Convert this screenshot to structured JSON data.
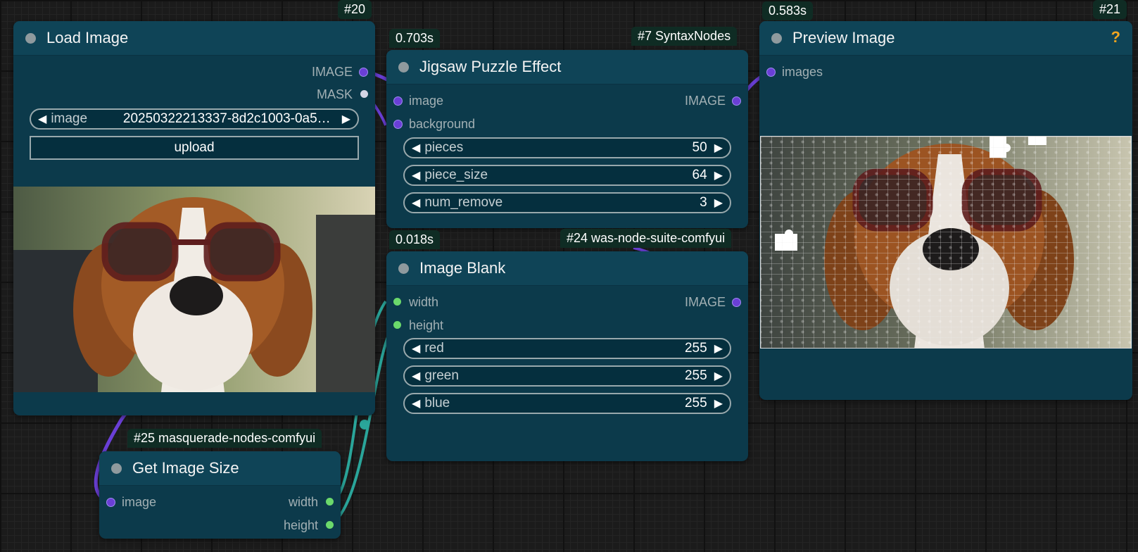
{
  "nodes": {
    "load_image": {
      "id": "#20",
      "title": "Load Image",
      "outputs": [
        "IMAGE",
        "MASK"
      ],
      "image_widget": {
        "name": "image",
        "value": "20250322213337-8d2c1003-0a5…"
      },
      "upload_label": "upload"
    },
    "jigsaw": {
      "time": "0.703s",
      "source": "#7 SyntaxNodes",
      "title": "Jigsaw Puzzle Effect",
      "inputs": [
        "image",
        "background"
      ],
      "output": "IMAGE",
      "widgets": [
        {
          "name": "pieces",
          "value": "50"
        },
        {
          "name": "piece_size",
          "value": "64"
        },
        {
          "name": "num_remove",
          "value": "3"
        }
      ]
    },
    "image_blank": {
      "time": "0.018s",
      "source": "#24 was-node-suite-comfyui",
      "title": "Image Blank",
      "inputs": [
        "width",
        "height"
      ],
      "output": "IMAGE",
      "widgets": [
        {
          "name": "red",
          "value": "255"
        },
        {
          "name": "green",
          "value": "255"
        },
        {
          "name": "blue",
          "value": "255"
        }
      ]
    },
    "preview": {
      "time": "0.583s",
      "id": "#21",
      "title": "Preview Image",
      "help": "?",
      "input": "images"
    },
    "get_size": {
      "source": "#25 masquerade-nodes-comfyui",
      "title": "Get Image Size",
      "input": "image",
      "outputs": [
        "width",
        "height"
      ]
    }
  },
  "arrows": {
    "left": "◀",
    "right": "▶"
  },
  "colors": {
    "canvas": "#1b1b1b",
    "node_body": "#0c3a4b",
    "node_header": "#0f4457",
    "image_link": "#6a3fd6",
    "int_link": "#2aa59a",
    "help": "#f2a51f"
  },
  "icons": {
    "help": "help-icon",
    "arrow_left": "triangle-left-icon",
    "arrow_right": "triangle-right-icon"
  }
}
